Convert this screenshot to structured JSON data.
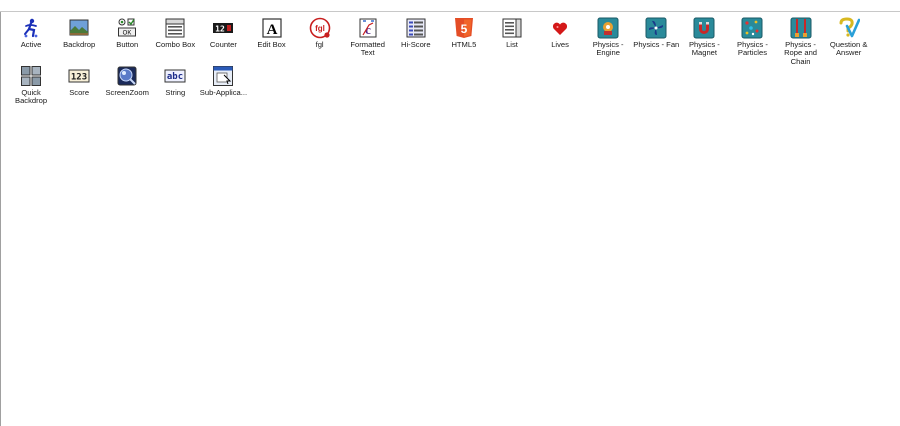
{
  "objects": [
    {
      "label": "Active",
      "icon": "active-icon"
    },
    {
      "label": "Backdrop",
      "icon": "backdrop-icon"
    },
    {
      "label": "Button",
      "icon": "button-icon"
    },
    {
      "label": "Combo Box",
      "icon": "combo-box-icon"
    },
    {
      "label": "Counter",
      "icon": "counter-icon"
    },
    {
      "label": "Edit Box",
      "icon": "edit-box-icon"
    },
    {
      "label": "fgl",
      "icon": "fgl-icon"
    },
    {
      "label": "Formatted Text",
      "icon": "formatted-text-icon"
    },
    {
      "label": "Hi-Score",
      "icon": "hi-score-icon"
    },
    {
      "label": "HTML5",
      "icon": "html5-icon"
    },
    {
      "label": "List",
      "icon": "list-icon"
    },
    {
      "label": "Lives",
      "icon": "lives-icon"
    },
    {
      "label": "Physics - Engine",
      "icon": "physics-engine-icon"
    },
    {
      "label": "Physics - Fan",
      "icon": "physics-fan-icon"
    },
    {
      "label": "Physics - Magnet",
      "icon": "physics-magnet-icon"
    },
    {
      "label": "Physics - Particles",
      "icon": "physics-particles-icon"
    },
    {
      "label": "Physics - Rope and Chain",
      "icon": "physics-rope-icon"
    },
    {
      "label": "Question & Answer",
      "icon": "question-answer-icon"
    },
    {
      "label": "Quick Backdrop",
      "icon": "quick-backdrop-icon"
    },
    {
      "label": "Score",
      "icon": "score-icon"
    },
    {
      "label": "ScreenZoom",
      "icon": "screenzoom-icon"
    },
    {
      "label": "String",
      "icon": "string-icon"
    },
    {
      "label": "Sub-Applica...",
      "icon": "sub-application-icon"
    }
  ],
  "counter_digits": "12",
  "score_digits": "123",
  "string_text": "abc",
  "fgl_text": "fgl",
  "html5_digit": "5",
  "edit_letter": "A"
}
